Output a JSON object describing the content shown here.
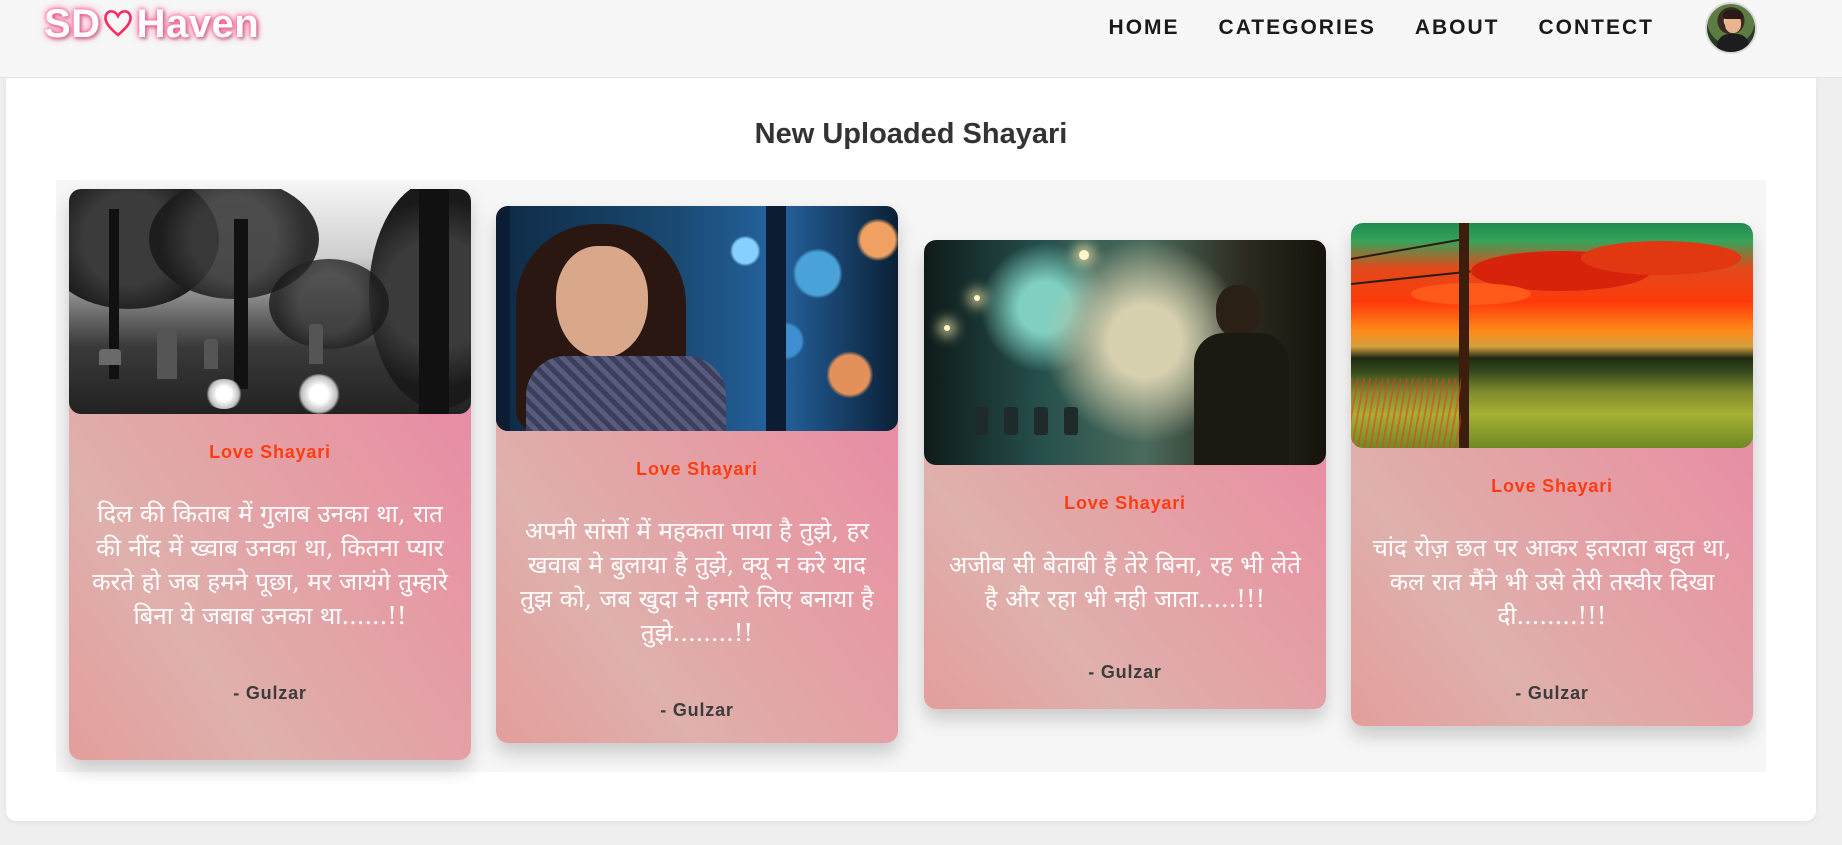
{
  "brand": {
    "logo_prefix": "SD",
    "logo_suffix": "Haven",
    "heart_icon": "heart-outline-icon",
    "accent_color": "#ff3d7a"
  },
  "nav": {
    "items": [
      {
        "label": "HOME"
      },
      {
        "label": "CATEGORIES"
      },
      {
        "label": "ABOUT"
      },
      {
        "label": "CONTECT"
      }
    ]
  },
  "section": {
    "title": "New Uploaded Shayari"
  },
  "cards": [
    {
      "category": "Love Shayari",
      "quote": "दिल की किताब में गुलाब उनका था, रात की नींद में ख्वाब उनका था, कितना प्यार करते हो जब हमने पूछा, मर जायंगे तुम्हारे बिना ये जबाब उनका था......!!",
      "author": "- Gulzar"
    },
    {
      "category": "Love Shayari",
      "quote": "अपनी सांसों में महकता पाया है तुझे, हर खवाब मे बुलाया है तुझे, क्यू न करे याद तुझ को, जब खुदा ने हमारे लिए बनाया है तुझे........!!",
      "author": "- Gulzar"
    },
    {
      "category": "Love Shayari",
      "quote": "अजीब सी बेताबी है तेरे बिना, रह भी लेते है और रहा भी नही जाता.....!!!",
      "author": "- Gulzar"
    },
    {
      "category": "Love Shayari",
      "quote": "चांद रोज़ छत पर आकर इतराता बहुत था, कल रात मैंने भी उसे तेरी तस्वीर दिखा दी........!!!",
      "author": "- Gulzar"
    }
  ],
  "colors": {
    "category_text": "#ff3d12",
    "card_gradient_pink": "#e682a8",
    "card_gradient_peach": "#e6a4a0"
  }
}
